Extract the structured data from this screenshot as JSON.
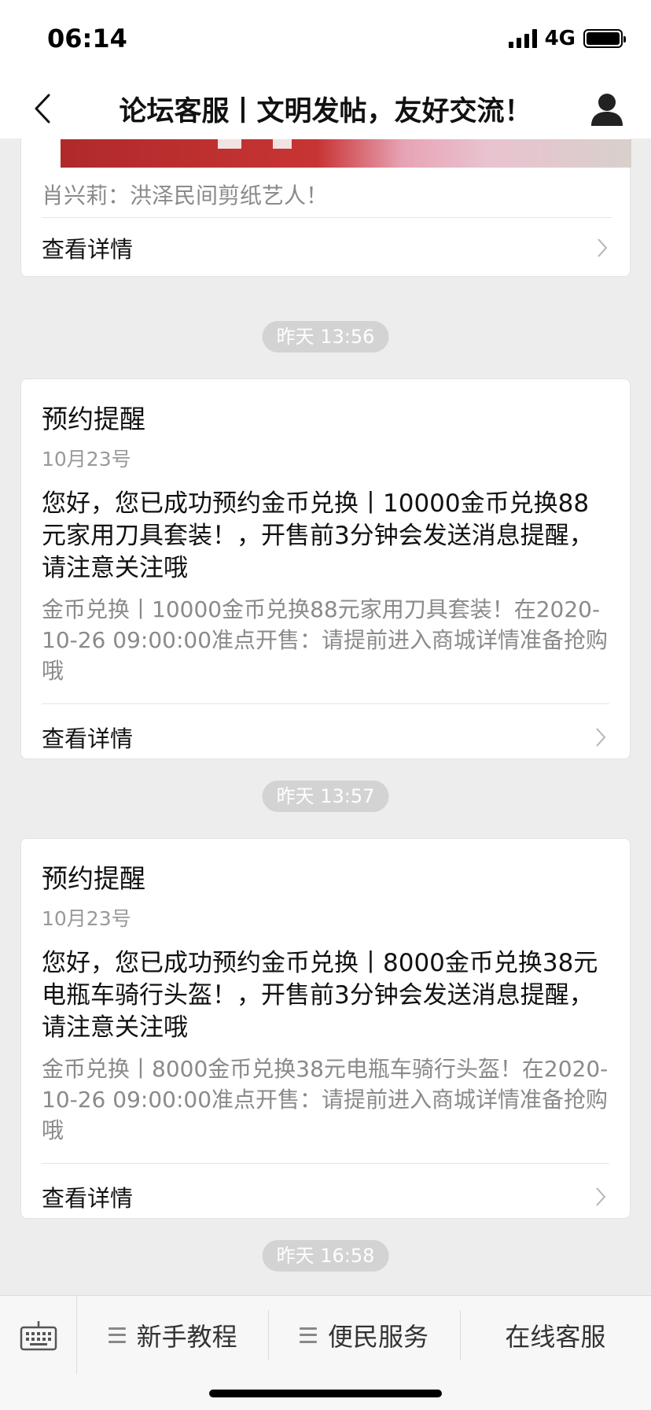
{
  "status_bar": {
    "time": "06:14",
    "network": "4G"
  },
  "nav": {
    "title": "论坛客服丨文明发帖，友好交流！"
  },
  "cards": [
    {
      "caption": "肖兴莉：洪泽民间剪纸艺人！",
      "footer": "查看详情"
    },
    {
      "timestamp": "昨天 13:56",
      "title": "预约提醒",
      "date": "10月23号",
      "body": "您好，您已成功预约金币兑换丨10000金币兑换88元家用刀具套装！，开售前3分钟会发送消息提醒，请注意关注哦",
      "desc": "金币兑换丨10000金币兑换88元家用刀具套装！在2020-10-26 09:00:00准点开售：请提前进入商城详情准备抢购哦",
      "footer": "查看详情"
    },
    {
      "timestamp": "昨天 13:57",
      "title": "预约提醒",
      "date": "10月23号",
      "body": "您好，您已成功预约金币兑换丨8000金币兑换38元电瓶车骑行头盔！，开售前3分钟会发送消息提醒，请注意关注哦",
      "desc": "金币兑换丨8000金币兑换38元电瓶车骑行头盔！在2020-10-26 09:00:00准点开售：请提前进入商城详情准备抢购哦",
      "footer": "查看详情"
    }
  ],
  "last_timestamp": "昨天 16:58",
  "bottom_menu": [
    {
      "label": "新手教程"
    },
    {
      "label": "便民服务"
    },
    {
      "label": "在线客服"
    }
  ],
  "colors": {
    "background": "#ededed",
    "card": "#ffffff",
    "pill": "#d3d3d3",
    "muted_text": "#999999"
  }
}
